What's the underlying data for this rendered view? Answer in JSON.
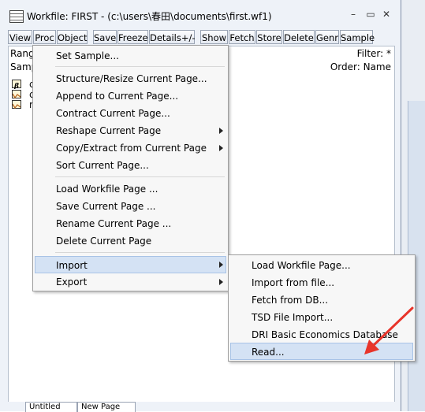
{
  "window": {
    "title": "Workfile: FIRST - (c:\\users\\春田\\documents\\first.wf1)",
    "minimize_glyph": "–",
    "restore_glyph": "▭",
    "close_glyph": "✕"
  },
  "toolbar": {
    "buttons": [
      "View",
      "Proc",
      "Object",
      "Save",
      "Freeze",
      "Details+/-",
      "Show",
      "Fetch",
      "Store",
      "Delete",
      "Genr",
      "Sample"
    ]
  },
  "info": {
    "range_label": "Rang",
    "sample_label": "Samp",
    "filter_text": "Filter: *",
    "order_text": "Order: Name"
  },
  "objects": [
    {
      "icon": "coefficient-icon",
      "name": "c"
    },
    {
      "icon": "series-icon",
      "name": "c"
    },
    {
      "icon": "series-icon",
      "name": "r"
    }
  ],
  "tabs": [
    "Untitled",
    "New Page"
  ],
  "proc_menu": {
    "items": [
      {
        "label": "Set Sample...",
        "submenu": false
      },
      {
        "label": "Structure/Resize Current Page...",
        "submenu": false
      },
      {
        "label": "Append to Current Page...",
        "submenu": false
      },
      {
        "label": "Contract Current Page...",
        "submenu": false
      },
      {
        "label": "Reshape Current Page",
        "submenu": true
      },
      {
        "label": "Copy/Extract from Current Page",
        "submenu": true
      },
      {
        "label": "Sort Current Page...",
        "submenu": false
      },
      {
        "label": "Load Workfile Page ...",
        "submenu": false
      },
      {
        "label": "Save Current Page ...",
        "submenu": false
      },
      {
        "label": "Rename Current Page ...",
        "submenu": false
      },
      {
        "label": "Delete Current Page",
        "submenu": false
      },
      {
        "label": "Import",
        "submenu": true,
        "highlighted": true
      },
      {
        "label": "Export",
        "submenu": true
      }
    ]
  },
  "import_submenu": {
    "items": [
      {
        "label": "Load Workfile Page..."
      },
      {
        "label": "Import from file..."
      },
      {
        "label": "Fetch from DB..."
      },
      {
        "label": "TSD File Import..."
      },
      {
        "label": "DRI Basic Economics Database"
      },
      {
        "label": "Read...",
        "highlighted": true
      }
    ]
  },
  "colors": {
    "highlight": "#d4e2f4",
    "annotation_arrow": "#e8342a"
  }
}
